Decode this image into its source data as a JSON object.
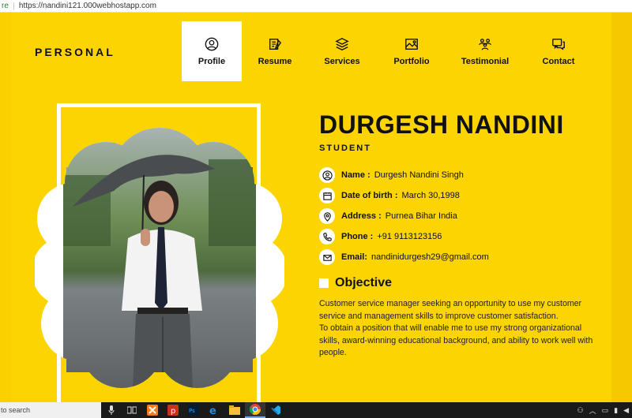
{
  "browser": {
    "protocol_fragment": "re",
    "url": "https://nandini121.000webhostapp.com"
  },
  "header": {
    "logo": "PERSONAL",
    "nav": [
      {
        "label": "Profile",
        "icon": "profile-icon",
        "active": true
      },
      {
        "label": "Resume",
        "icon": "resume-icon"
      },
      {
        "label": "Services",
        "icon": "layers-icon"
      },
      {
        "label": "Portfolio",
        "icon": "image-icon"
      },
      {
        "label": "Testimonial",
        "icon": "people-icon"
      },
      {
        "label": "Contact",
        "icon": "chat-icon"
      }
    ]
  },
  "profile": {
    "name": "DURGESH NANDINI",
    "role": "STUDENT",
    "details": [
      {
        "label": "Name :",
        "value": "Durgesh Nandini Singh",
        "icon": "user-icon"
      },
      {
        "label": "Date of birth :",
        "value": "March 30,1998",
        "icon": "calendar-icon"
      },
      {
        "label": "Address :",
        "value": "Purnea Bihar India",
        "icon": "location-icon"
      },
      {
        "label": "Phone :",
        "value": "+91 9113123156",
        "icon": "phone-icon"
      },
      {
        "label": "Email:",
        "value": "nandinidurgesh29@gmail.com",
        "icon": "mail-icon"
      }
    ],
    "objective_title": "Objective",
    "objective_text_1": "Customer service manager seeking an opportunity to use my customer service and management skills to improve customer satisfaction.",
    "objective_text_2": "To obtain a position that will enable me to use my strong organizational skills, award-winning educational background, and ability to work well with people."
  },
  "taskbar": {
    "search_placeholder": "to search"
  },
  "colors": {
    "page_bg": "#fcd402",
    "text": "#111111",
    "active_tab_bg": "#ffffff"
  }
}
